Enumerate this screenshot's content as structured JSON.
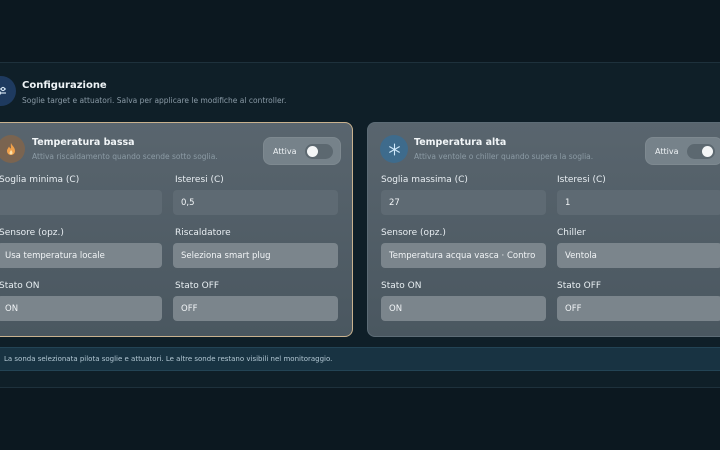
{
  "header": {
    "title": "Configurazione",
    "subtitle": "Soglie target e attuatori. Salva per applicare le modifiche al controller.",
    "icon": "sliders-icon"
  },
  "cards": {
    "low": {
      "title": "Temperatura bassa",
      "subtitle": "Attiva riscaldamento quando scende sotto soglia.",
      "icon": "flame-icon",
      "toggle_label": "Attiva",
      "toggle_on": false,
      "threshold_label": "Soglia minima (C)",
      "threshold_value": "",
      "hysteresis_label": "Isteresi (C)",
      "hysteresis_value": "0,5",
      "sensor_label": "Sensore (opz.)",
      "sensor_value": "Usa temperatura locale",
      "actuator_label": "Riscaldatore",
      "actuator_value": "Seleziona smart plug",
      "state_on_label": "Stato ON",
      "state_on_value": "ON",
      "state_off_label": "Stato OFF",
      "state_off_value": "OFF"
    },
    "high": {
      "title": "Temperatura alta",
      "subtitle": "Attiva ventole o chiller quando supera la soglia.",
      "icon": "snowflake-icon",
      "toggle_label": "Attiva",
      "toggle_on": true,
      "threshold_label": "Soglia massima (C)",
      "threshold_value": "27",
      "hysteresis_label": "Isteresi (C)",
      "hysteresis_value": "1",
      "sensor_label": "Sensore (opz.)",
      "sensor_value": "Temperatura acqua vasca · Contro",
      "actuator_label": "Chiller",
      "actuator_value": "Ventola",
      "state_on_label": "Stato ON",
      "state_on_value": "ON",
      "state_off_label": "Stato OFF",
      "state_off_value": "OFF"
    }
  },
  "info": {
    "text": "La sonda selezionata pilota soglie e attuatori. Le altre sonde restano visibili nel monitoraggio."
  },
  "colors": {
    "background": "#0c1820",
    "low_card_border": "#c9b28f",
    "low_icon_bg": "#8a6a4a",
    "high_icon_bg": "#3a6a8a"
  }
}
